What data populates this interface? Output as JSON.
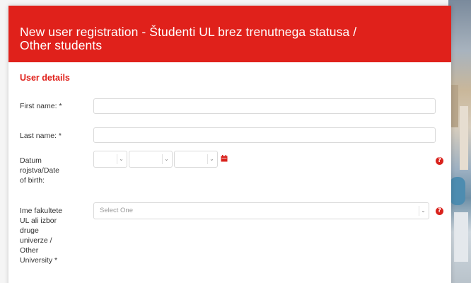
{
  "modal": {
    "title_line1": "New user registration - Študenti UL brez trenutnega statusa /",
    "title_line2": "Other students",
    "header_color": "#e0211b"
  },
  "user_details": {
    "section_title": "User details",
    "first_name_label": "First name: *",
    "first_name_value": "",
    "last_name_label": "Last name: *",
    "last_name_value": "",
    "dob_label_lines": [
      "Datum",
      "rojstva/Date",
      "of birth:"
    ],
    "dob_day": "",
    "dob_month": "",
    "dob_year": "",
    "faculty_label_lines": [
      "Ime fakultete",
      "UL ali izbor",
      "druge",
      "univerze /",
      "Other",
      "University *"
    ],
    "faculty_placeholder": "Select One"
  },
  "icons": {
    "calendar": "calendar-icon",
    "help": "question-circle-icon",
    "caret": "chevron-down-icon"
  }
}
